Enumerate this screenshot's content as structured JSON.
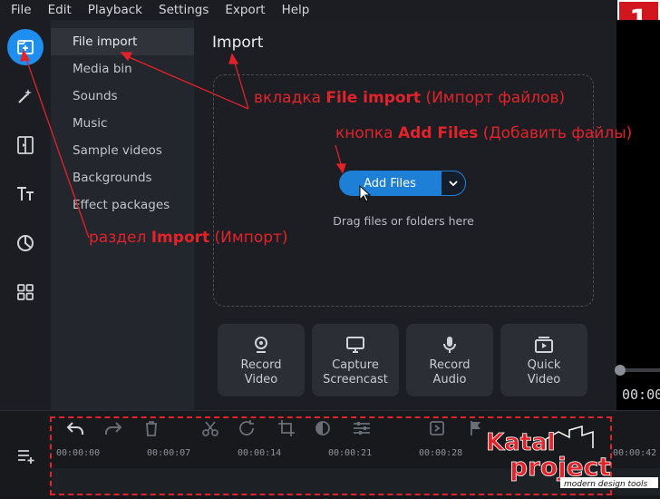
{
  "menubar": {
    "items": [
      "File",
      "Edit",
      "Playback",
      "Settings",
      "Export",
      "Help"
    ]
  },
  "step_badge": "1",
  "subnav": {
    "items": [
      "File import",
      "Media bin",
      "Sounds",
      "Music",
      "Sample videos",
      "Backgrounds",
      "Effect packages"
    ]
  },
  "import": {
    "title": "Import",
    "add_files_label": "Add Files",
    "drop_text": "Drag files or folders here"
  },
  "tiles": [
    {
      "line1": "Record",
      "line2": "Video"
    },
    {
      "line1": "Capture",
      "line2": "Screencast"
    },
    {
      "line1": "Record",
      "line2": "Audio"
    },
    {
      "line1": "Quick",
      "line2": "Video"
    }
  ],
  "timeline": {
    "ruler": [
      "00:00:00",
      "00:00:07",
      "00:00:14",
      "00:00:21",
      "00:00:28",
      "00:00:42"
    ]
  },
  "player": {
    "timer": "00:00"
  },
  "annotations": {
    "tab": {
      "pre": "вкладка ",
      "bold": "File import",
      "post": " (Импорт файлов)"
    },
    "button": {
      "pre": "кнопка ",
      "bold": "Add Files",
      "post": " (Добавить файлы)"
    },
    "section": {
      "pre": "раздел ",
      "bold": "Import",
      "post": " (Импорт)"
    }
  },
  "logo": {
    "word1": "Katal",
    "word2": "project",
    "tagline": "modern design tools"
  },
  "colors": {
    "accent": "#1e8ef0",
    "annotation": "#e2232a",
    "badge": "#d2161d"
  }
}
